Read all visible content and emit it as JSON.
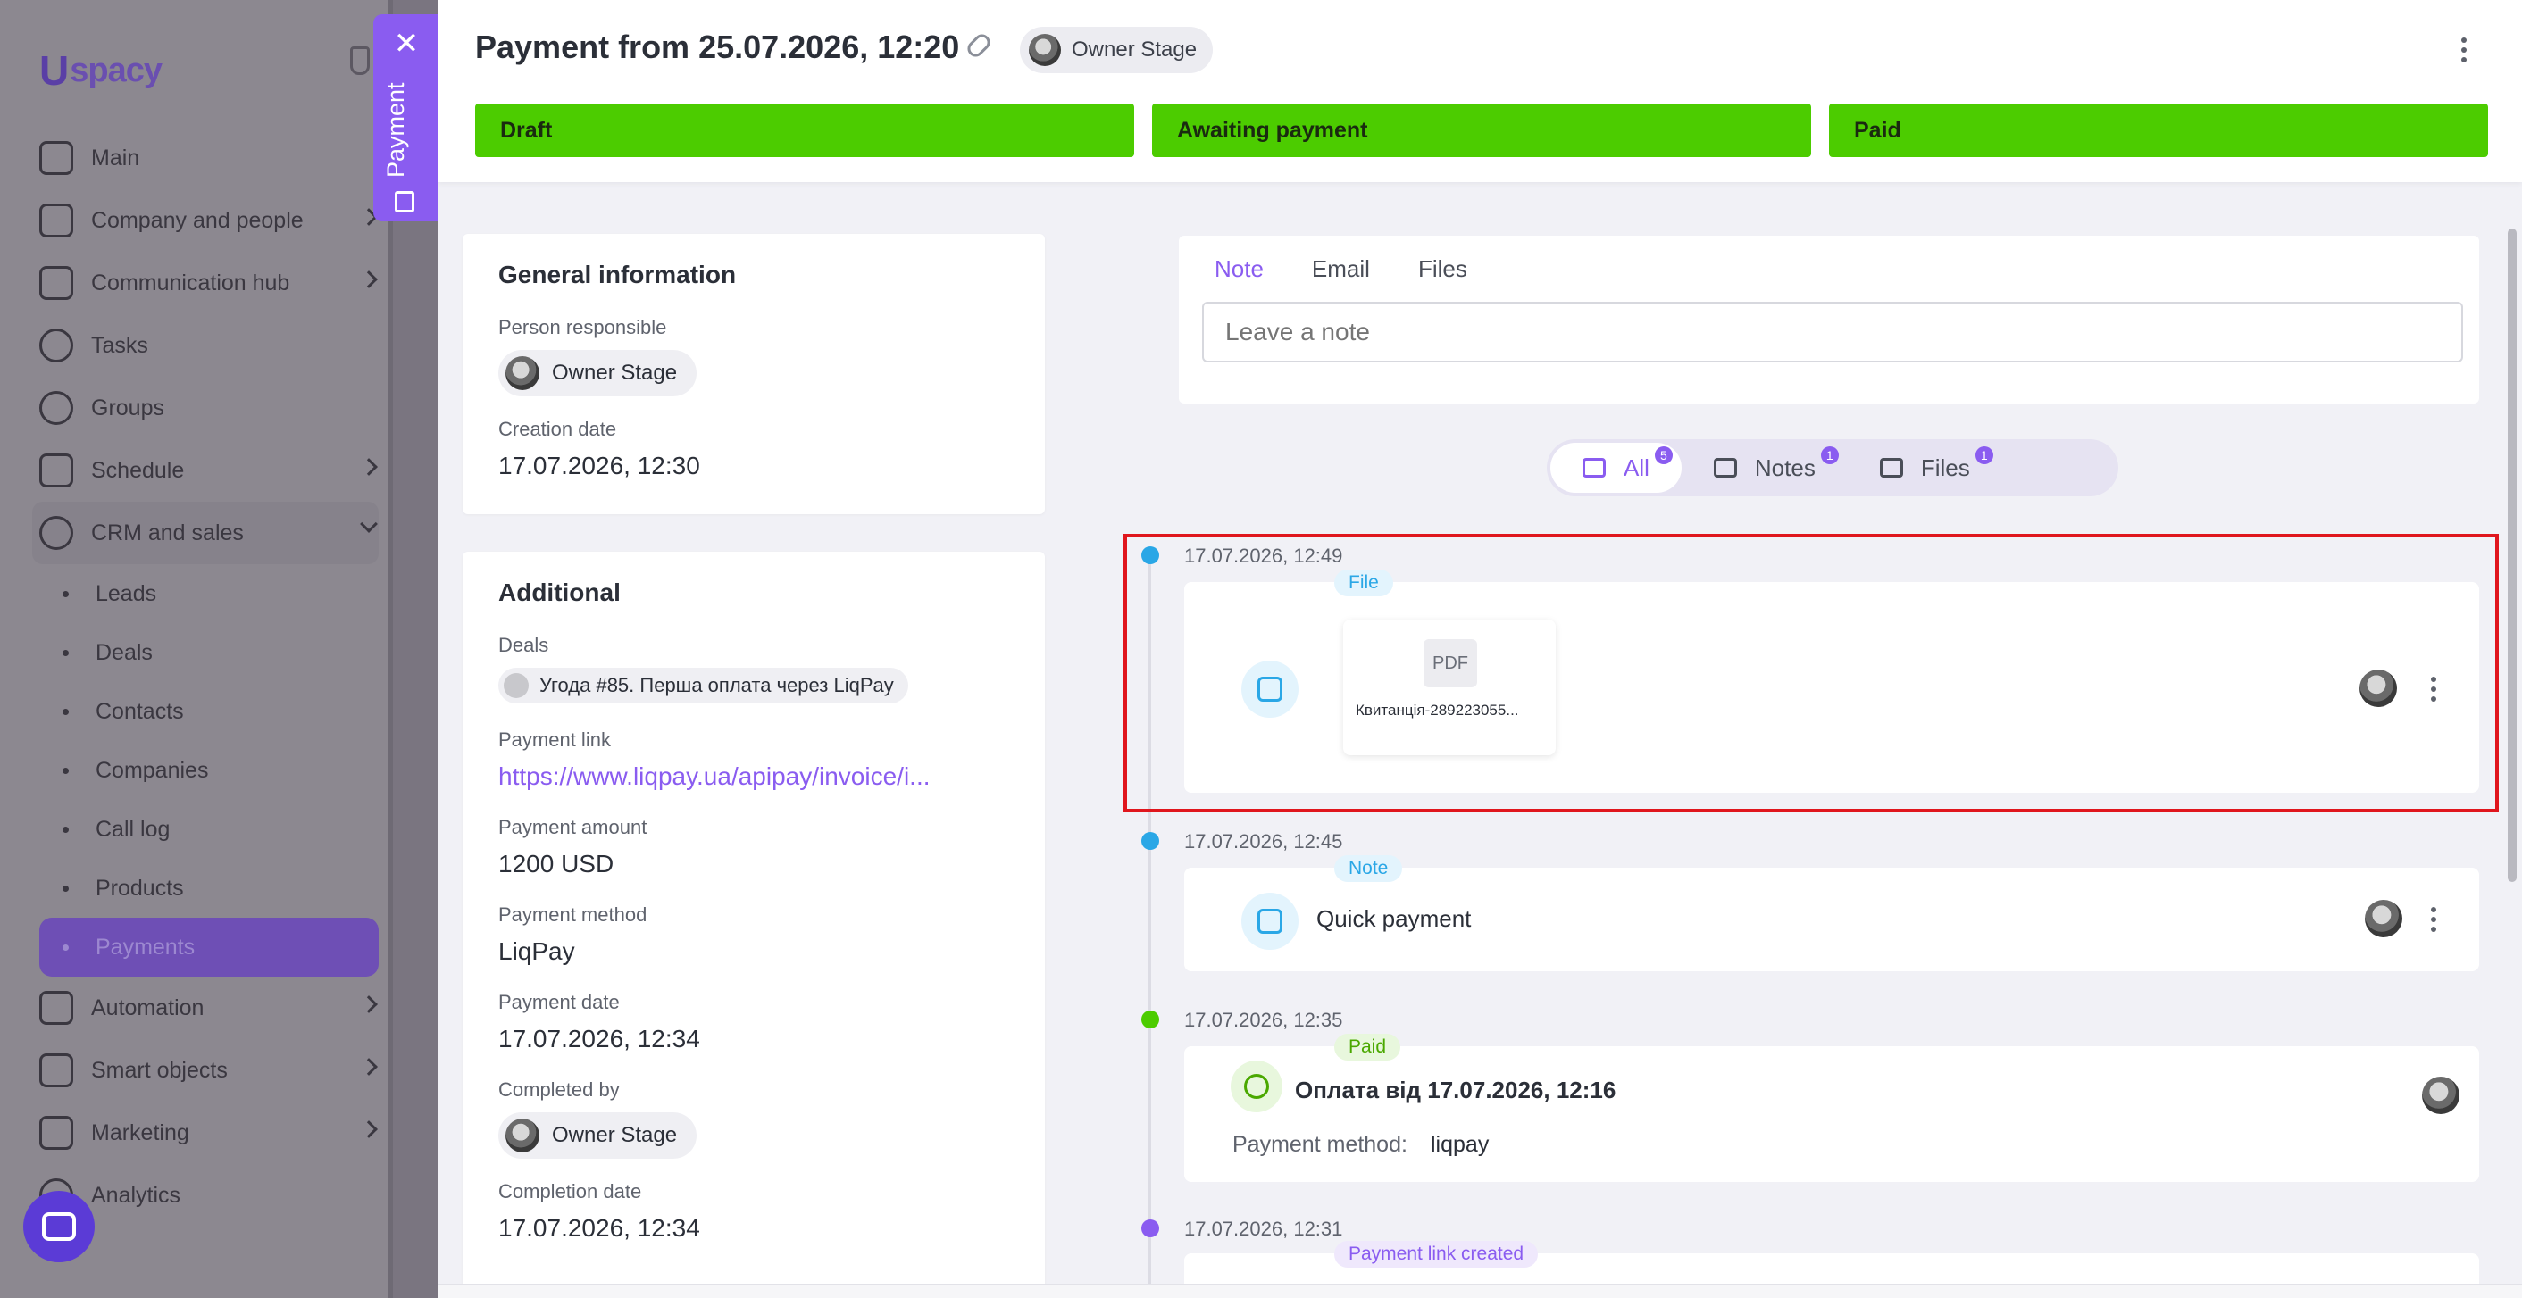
{
  "sidebar": {
    "logo_mark": "U",
    "logo_text": "spacy",
    "nav": [
      {
        "label": "Main"
      },
      {
        "label": "Company and people"
      },
      {
        "label": "Communication hub"
      },
      {
        "label": "Tasks"
      },
      {
        "label": "Groups"
      },
      {
        "label": "Schedule"
      },
      {
        "label": "CRM and sales"
      }
    ],
    "crm_sub": [
      "Leads",
      "Deals",
      "Contacts",
      "Companies",
      "Call log",
      "Products",
      "Payments"
    ],
    "nav_bottom": [
      {
        "label": "Automation"
      },
      {
        "label": "Smart objects"
      },
      {
        "label": "Marketing"
      },
      {
        "label": "Analytics"
      }
    ]
  },
  "drawer": {
    "label": "Payment",
    "close": "✕"
  },
  "header": {
    "title": "Payment from 25.07.2026, 12:20",
    "owner": "Owner Stage",
    "stages": [
      "Draft",
      "Awaiting payment",
      "Paid"
    ]
  },
  "general": {
    "title": "General information",
    "person_label": "Person responsible",
    "person": "Owner Stage",
    "creation_label": "Creation date",
    "creation": "17.07.2026, 12:30"
  },
  "additional": {
    "title": "Additional",
    "deals_label": "Deals",
    "deal": "Угода #85. Перша оплата через LiqPay",
    "link_label": "Payment link",
    "link": "https://www.liqpay.ua/apipay/invoice/i...",
    "amount_label": "Payment amount",
    "amount": "1200 USD",
    "method_label": "Payment method",
    "method": "LiqPay",
    "date_label": "Payment date",
    "date": "17.07.2026, 12:34",
    "completed_label": "Completed by",
    "completed": "Owner Stage",
    "completion_label": "Completion date",
    "completion": "17.07.2026, 12:34"
  },
  "composer": {
    "tabs": [
      "Note",
      "Email",
      "Files"
    ],
    "placeholder": "Leave a note"
  },
  "filters": {
    "all": "All",
    "all_count": "5",
    "notes": "Notes",
    "notes_count": "1",
    "files": "Files",
    "files_count": "1"
  },
  "timeline": [
    {
      "date": "17.07.2026, 12:49",
      "tag": "File",
      "pdf": "PDF",
      "filename": "Квитанція-289223055..."
    },
    {
      "date": "17.07.2026, 12:45",
      "tag": "Note",
      "text": "Quick payment"
    },
    {
      "date": "17.07.2026, 12:35",
      "tag": "Paid",
      "text": "Оплата від 17.07.2026, 12:16",
      "pm_label": "Payment method:",
      "pm_value": "liqpay"
    },
    {
      "date": "17.07.2026, 12:31",
      "tag": "Payment link created"
    }
  ],
  "colors": {
    "accent": "#8a5cf0",
    "stage_green": "#4ccc00",
    "highlight": "#e0161d"
  }
}
